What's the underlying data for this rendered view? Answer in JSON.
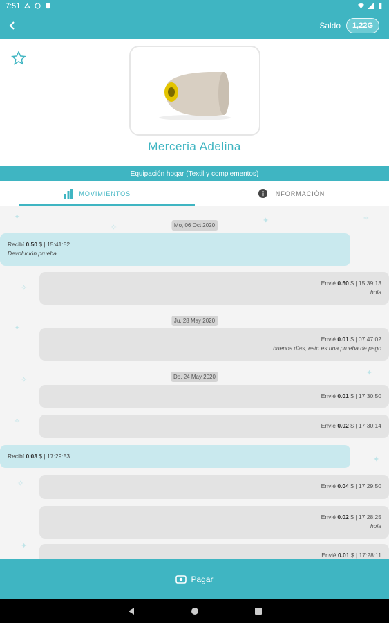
{
  "status_bar": {
    "time": "7:51"
  },
  "app_bar": {
    "balance_label": "Saldo",
    "balance_value": "1,22G"
  },
  "header": {
    "store_name": "Merceria Adelina"
  },
  "category": "Equipación hogar (Textil y complementos)",
  "tabs": [
    {
      "label": "MOVIMIENTOS",
      "icon": "bar-chart-icon",
      "active": true
    },
    {
      "label": "INFORMACIÓN",
      "icon": "info-icon",
      "active": false
    }
  ],
  "feed": {
    "dates": [
      "Mo, 06 Oct 2020",
      "Ju, 28 May 2020",
      "Do, 24 May 2020"
    ],
    "messages": [
      {
        "type": "recv",
        "verb": "Recibí",
        "amount": "0.50",
        "currency": "$",
        "time": "15:41:52",
        "note": "Devolución prueba"
      },
      {
        "type": "sent",
        "verb": "Envié",
        "amount": "0.50",
        "currency": "$",
        "time": "15:39:13",
        "note": "hola"
      },
      {
        "type": "sent",
        "verb": "Envié",
        "amount": "0.01",
        "currency": "$",
        "time": "07:47:02",
        "note": "buenos días, esto es una prueba de pago"
      },
      {
        "type": "sent",
        "verb": "Envié",
        "amount": "0.01",
        "currency": "$",
        "time": "17:30:50",
        "note": ""
      },
      {
        "type": "sent",
        "verb": "Envié",
        "amount": "0.02",
        "currency": "$",
        "time": "17:30:14",
        "note": ""
      },
      {
        "type": "recv",
        "verb": "Recibí",
        "amount": "0.03",
        "currency": "$",
        "time": "17:29:53",
        "note": ""
      },
      {
        "type": "sent",
        "verb": "Envié",
        "amount": "0.04",
        "currency": "$",
        "time": "17:29:50",
        "note": ""
      },
      {
        "type": "sent",
        "verb": "Envié",
        "amount": "0.02",
        "currency": "$",
        "time": "17:28:25",
        "note": "hola"
      },
      {
        "type": "sent",
        "verb": "Envié",
        "amount": "0.01",
        "currency": "$",
        "time": "17:28:11",
        "note": ""
      }
    ]
  },
  "pay_button": {
    "label": "Pagar"
  },
  "colors": {
    "accent": "#3fb5c2",
    "received_bubble": "#c9e9ee",
    "sent_bubble": "#e3e3e3"
  }
}
